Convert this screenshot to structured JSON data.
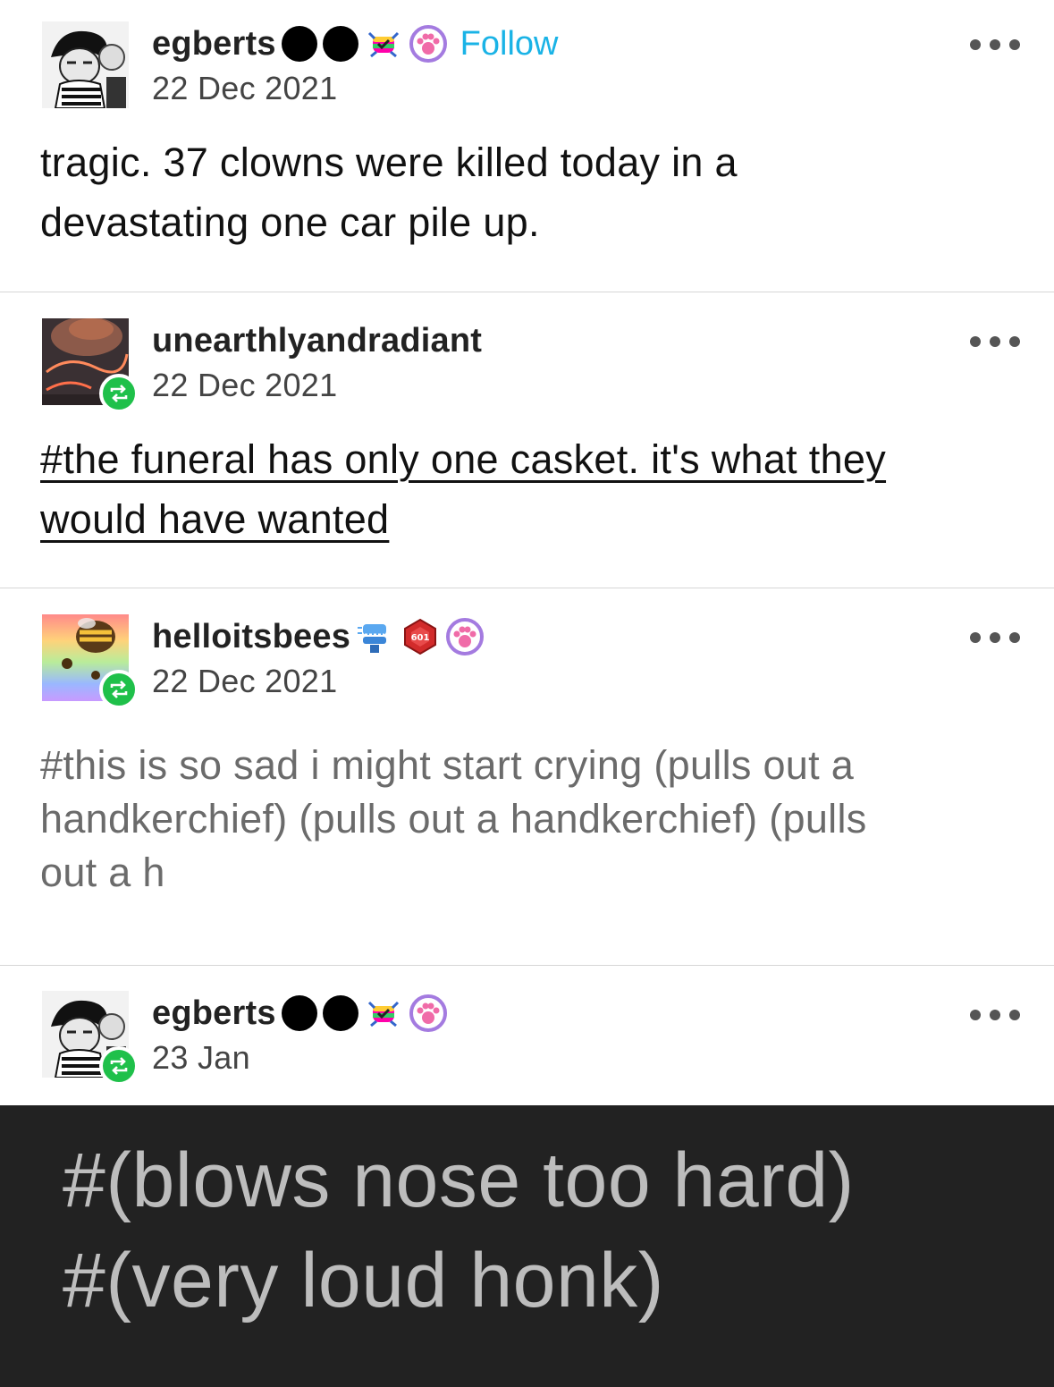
{
  "posts": [
    {
      "username": "egberts",
      "date": "22 Dec 2021",
      "follow_label": "Follow",
      "badges": [
        "black-dot-badge",
        "black-dot-badge",
        "rainbow-crab-badge",
        "paw-badge"
      ],
      "text_lines": [
        "tragic. 37 clowns were killed today in a",
        "devastating one car pile up."
      ]
    },
    {
      "username": "unearthlyandradiant",
      "date": "22 Dec 2021",
      "reblogged": true,
      "tag_lines": [
        "#the funeral has only one casket. it's what they",
        "would have wanted"
      ]
    },
    {
      "username": "helloitsbees",
      "date": "22 Dec 2021",
      "reblogged": true,
      "badges": [
        "chattering-teeth-badge",
        "red-dice-badge",
        "paw-badge"
      ],
      "tag_lines": [
        "#this is so sad i might start crying (pulls out a",
        "handkerchief) (pulls out a handkerchief) (pulls",
        "out a h"
      ]
    },
    {
      "username": "egberts",
      "date": "23 Jan",
      "reblogged": true,
      "badges": [
        "black-dot-badge",
        "black-dot-badge",
        "rainbow-crab-badge",
        "paw-badge"
      ],
      "tag_lines": [
        "#(blows nose too hard)",
        "#(very loud honk)"
      ]
    }
  ],
  "colors": {
    "follow": "#1ab3e6",
    "reblog": "#1fc04a",
    "dark_panel": "#222222"
  }
}
